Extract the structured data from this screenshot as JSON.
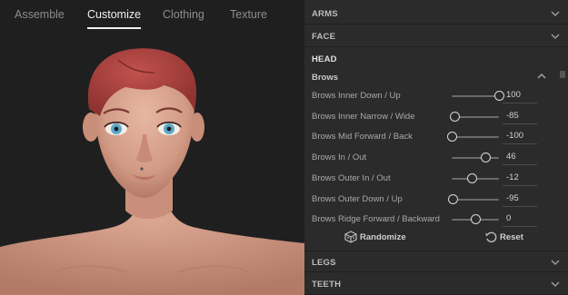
{
  "tabs": [
    "Assemble",
    "Customize",
    "Clothing",
    "Texture"
  ],
  "active_tab": "Customize",
  "sections": {
    "arms": "ARMS",
    "face": "FACE",
    "head": "HEAD",
    "legs": "LEGS",
    "teeth": "TEETH"
  },
  "subsection": "Brows",
  "params": [
    {
      "label": "Brows Inner Down / Up",
      "value": "100",
      "level": 1.0
    },
    {
      "label": "Brows Inner Narrow / Wide",
      "value": "-85",
      "level": 0.075
    },
    {
      "label": "Brows Mid Forward / Back",
      "value": "-100",
      "level": 0.0
    },
    {
      "label": "Brows In / Out",
      "value": "46",
      "level": 0.73
    },
    {
      "label": "Brows Outer In / Out",
      "value": "-12",
      "level": 0.44
    },
    {
      "label": "Brows Outer Down / Up",
      "value": "-95",
      "level": 0.025
    },
    {
      "label": "Brows Ridge Forward / Backward",
      "value": "0",
      "level": 0.5
    }
  ],
  "actions": {
    "randomize": "Randomize",
    "reset": "Reset"
  },
  "icons": {
    "collapse": "chevron-down-icon",
    "expand": "chevron-up-icon",
    "randomize": "dice-icon",
    "reset": "undo-icon"
  },
  "colors": {
    "panel_bg": "#2b2b2b",
    "viewport_bg": "#1f1f1f",
    "hair": "#a8403d",
    "skin": "#d9a08c",
    "eyes": "#5ca8c8"
  }
}
